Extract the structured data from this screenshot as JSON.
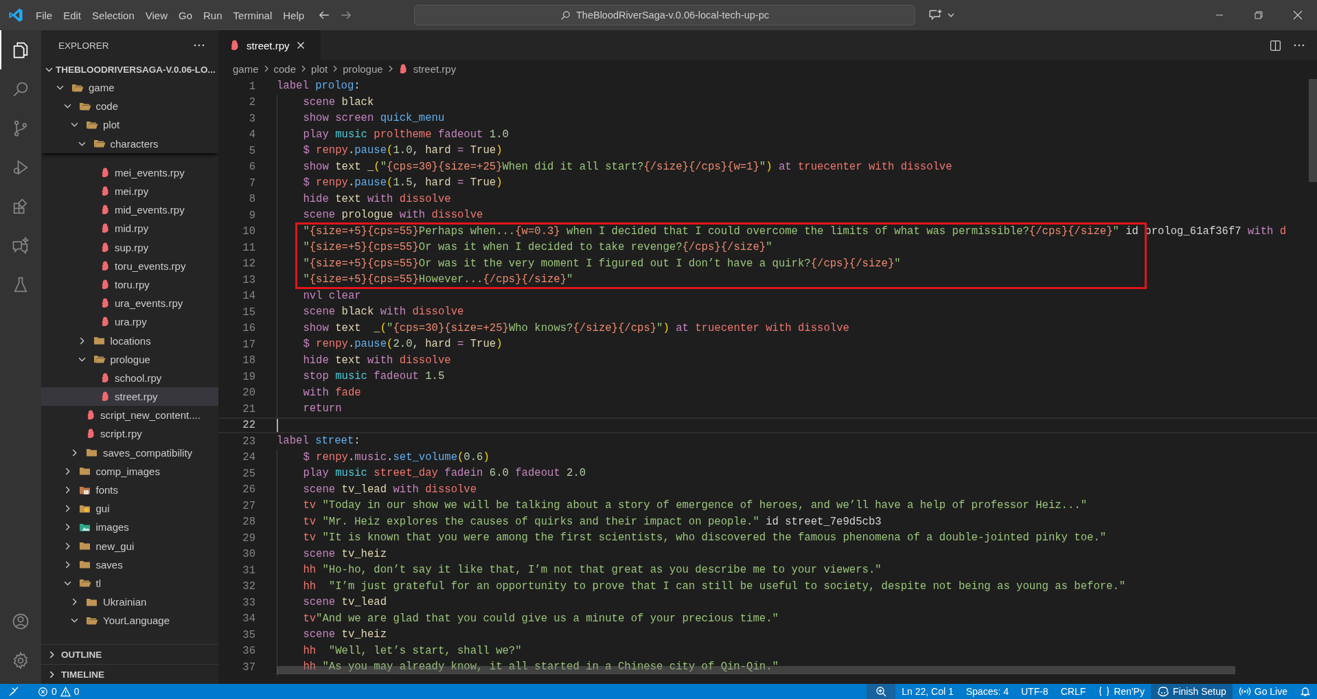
{
  "title_bar": {
    "menu": [
      "File",
      "Edit",
      "Selection",
      "View",
      "Go",
      "Run",
      "Terminal",
      "Help"
    ],
    "search": "TheBloodRiverSaga-v.0.06-local-tech-up-pc"
  },
  "activity_bar": {
    "top": [
      {
        "kind": "explorer",
        "selected": true
      },
      {
        "kind": "search",
        "selected": false
      },
      {
        "kind": "source-control",
        "selected": false
      },
      {
        "kind": "debug",
        "selected": false
      },
      {
        "kind": "extensions",
        "selected": false
      },
      {
        "kind": "chat",
        "selected": false
      },
      {
        "kind": "testing",
        "selected": false
      }
    ],
    "bottom": [
      {
        "kind": "account"
      },
      {
        "kind": "settings"
      }
    ]
  },
  "sidebar": {
    "title": "EXPLORER",
    "project": {
      "label": "THEBLOODRIVERSAGA-V.0.06-LO...",
      "expanded": true
    },
    "tree": [
      {
        "label": "game",
        "kind": "folder",
        "expanded": true,
        "selected": false,
        "children": [
          {
            "label": "code",
            "kind": "folder",
            "expanded": true,
            "selected": false,
            "children": [
              {
                "label": "plot",
                "kind": "folder",
                "expanded": true,
                "selected": false,
                "children": [
                  {
                    "label": "characters",
                    "kind": "folder",
                    "expanded": true,
                    "selected": false,
                    "children": [
                      {
                        "label": "mei_events.rpy",
                        "kind": "file",
                        "selected": false
                      },
                      {
                        "label": "mei.rpy",
                        "kind": "file",
                        "selected": false
                      },
                      {
                        "label": "mid_events.rpy",
                        "kind": "file",
                        "selected": false
                      },
                      {
                        "label": "mid.rpy",
                        "kind": "file",
                        "selected": false
                      },
                      {
                        "label": "sup.rpy",
                        "kind": "file",
                        "selected": false
                      },
                      {
                        "label": "toru_events.rpy",
                        "kind": "file",
                        "selected": false
                      },
                      {
                        "label": "toru.rpy",
                        "kind": "file",
                        "selected": false
                      },
                      {
                        "label": "ura_events.rpy",
                        "kind": "file",
                        "selected": false
                      },
                      {
                        "label": "ura.rpy",
                        "kind": "file",
                        "selected": false
                      }
                    ]
                  },
                  {
                    "label": "locations",
                    "kind": "folder",
                    "expanded": false,
                    "selected": false
                  },
                  {
                    "label": "prologue",
                    "kind": "folder",
                    "expanded": true,
                    "selected": false,
                    "children": [
                      {
                        "label": "school.rpy",
                        "kind": "file",
                        "selected": false
                      },
                      {
                        "label": "street.rpy",
                        "kind": "file",
                        "selected": true
                      }
                    ]
                  }
                ]
              },
              {
                "label": "script_new_content....",
                "kind": "file",
                "selected": false
              },
              {
                "label": "script.rpy",
                "kind": "file",
                "selected": false
              },
              {
                "label": "saves_compatibility",
                "kind": "folder",
                "expanded": false,
                "selected": false
              }
            ]
          },
          {
            "label": "comp_images",
            "kind": "folder",
            "expanded": false,
            "selected": false
          },
          {
            "label": "fonts",
            "kind": "font-folder",
            "expanded": false,
            "selected": false
          },
          {
            "label": "gui",
            "kind": "gui-folder",
            "expanded": false,
            "selected": false
          },
          {
            "label": "images",
            "kind": "image-folder",
            "expanded": false,
            "selected": false
          },
          {
            "label": "new_gui",
            "kind": "folder",
            "expanded": false,
            "selected": false
          },
          {
            "label": "saves",
            "kind": "folder",
            "expanded": false,
            "selected": false
          },
          {
            "label": "tl",
            "kind": "folder",
            "expanded": true,
            "selected": false,
            "children": [
              {
                "label": "Ukrainian",
                "kind": "folder",
                "expanded": false,
                "selected": false
              },
              {
                "label": "YourLanguage",
                "kind": "folder",
                "expanded": true,
                "selected": false
              }
            ]
          }
        ]
      }
    ],
    "sections": [
      {
        "label": "OUTLINE",
        "expanded": false
      },
      {
        "label": "TIMELINE",
        "expanded": false
      }
    ]
  },
  "tabs": [
    {
      "label": "street.rpy",
      "selected": true
    }
  ],
  "breadcrumb": [
    {
      "label": "game",
      "kind": "folder"
    },
    {
      "label": "code",
      "kind": "folder"
    },
    {
      "label": "plot",
      "kind": "folder"
    },
    {
      "label": "prologue",
      "kind": "folder"
    },
    {
      "label": "street.rpy",
      "kind": "file"
    }
  ],
  "editor": {
    "lines": [
      {
        "n": "1",
        "indented": false,
        "current": false,
        "boxed": false,
        "tokens": [
          {
            "kind": "kw",
            "text": "label "
          },
          {
            "kind": "name",
            "text": "prolog"
          },
          {
            "kind": "pl",
            "text": ":"
          }
        ]
      },
      {
        "n": "2",
        "indented": true,
        "current": false,
        "boxed": false,
        "tokens": [
          {
            "kind": "kw",
            "text": "scene "
          },
          {
            "kind": "id",
            "text": "black"
          }
        ]
      },
      {
        "n": "3",
        "indented": true,
        "current": false,
        "boxed": false,
        "tokens": [
          {
            "kind": "kw",
            "text": "show screen "
          },
          {
            "kind": "name",
            "text": "quick_menu"
          }
        ]
      },
      {
        "n": "4",
        "indented": true,
        "current": false,
        "boxed": false,
        "tokens": [
          {
            "kind": "kw",
            "text": "play "
          },
          {
            "kind": "music",
            "text": "music "
          },
          {
            "kind": "red",
            "text": "proltheme "
          },
          {
            "kind": "kw",
            "text": "fadeout "
          },
          {
            "kind": "num",
            "text": "1.0"
          }
        ]
      },
      {
        "n": "5",
        "indented": true,
        "current": false,
        "boxed": false,
        "tokens": [
          {
            "kind": "kw",
            "text": "$ "
          },
          {
            "kind": "red",
            "text": "renpy"
          },
          {
            "kind": "pl",
            "text": "."
          },
          {
            "kind": "name",
            "text": "pause"
          },
          {
            "kind": "paren",
            "text": "("
          },
          {
            "kind": "num",
            "text": "1.0"
          },
          {
            "kind": "pl",
            "text": ", "
          },
          {
            "kind": "id",
            "text": "hard "
          },
          {
            "kind": "kw",
            "text": "= "
          },
          {
            "kind": "id",
            "text": "True"
          },
          {
            "kind": "paren",
            "text": ")"
          }
        ]
      },
      {
        "n": "6",
        "indented": true,
        "current": false,
        "boxed": false,
        "tokens": [
          {
            "kind": "kw",
            "text": "show "
          },
          {
            "kind": "id",
            "text": "text _"
          },
          {
            "kind": "paren",
            "text": "("
          },
          {
            "kind": "str",
            "text": "\""
          },
          {
            "kind": "tag",
            "text": "{cps=30}{size=+25}"
          },
          {
            "kind": "str",
            "text": "When did it all start?"
          },
          {
            "kind": "tag",
            "text": "{/size}{/cps}{w=1}"
          },
          {
            "kind": "str",
            "text": "\""
          },
          {
            "kind": "paren",
            "text": ")"
          },
          {
            "kind": "kw",
            "text": " at "
          },
          {
            "kind": "red",
            "text": "truecenter with dissolve"
          }
        ]
      },
      {
        "n": "7",
        "indented": true,
        "current": false,
        "boxed": false,
        "tokens": [
          {
            "kind": "kw",
            "text": "$ "
          },
          {
            "kind": "red",
            "text": "renpy"
          },
          {
            "kind": "pl",
            "text": "."
          },
          {
            "kind": "name",
            "text": "pause"
          },
          {
            "kind": "paren",
            "text": "("
          },
          {
            "kind": "num",
            "text": "1.5"
          },
          {
            "kind": "pl",
            "text": ", "
          },
          {
            "kind": "id",
            "text": "hard "
          },
          {
            "kind": "kw",
            "text": "= "
          },
          {
            "kind": "id",
            "text": "True"
          },
          {
            "kind": "paren",
            "text": ")"
          }
        ]
      },
      {
        "n": "8",
        "indented": true,
        "current": false,
        "boxed": false,
        "tokens": [
          {
            "kind": "kw",
            "text": "hide "
          },
          {
            "kind": "id",
            "text": "text "
          },
          {
            "kind": "kw",
            "text": "with "
          },
          {
            "kind": "red",
            "text": "dissolve"
          }
        ]
      },
      {
        "n": "9",
        "indented": true,
        "current": false,
        "boxed": false,
        "tokens": [
          {
            "kind": "kw",
            "text": "scene "
          },
          {
            "kind": "id",
            "text": "prologue "
          },
          {
            "kind": "kw",
            "text": "with "
          },
          {
            "kind": "red",
            "text": "dissolve"
          }
        ]
      },
      {
        "n": "10",
        "indented": true,
        "current": false,
        "boxed": true,
        "tokens": [
          {
            "kind": "str",
            "text": "\""
          },
          {
            "kind": "tag",
            "text": "{size=+5}{cps=55}"
          },
          {
            "kind": "str",
            "text": "Perhaps when..."
          },
          {
            "kind": "tag",
            "text": "{w=0.3}"
          },
          {
            "kind": "str",
            "text": " when I decided that I could overcome the limits of what was permissible?"
          },
          {
            "kind": "tag",
            "text": "{/cps}{/size}"
          },
          {
            "kind": "str",
            "text": "\""
          },
          {
            "kind": "pl",
            "text": " id prolog_61af36f7 "
          },
          {
            "kind": "kw",
            "text": "with "
          },
          {
            "kind": "red",
            "text": "d"
          }
        ]
      },
      {
        "n": "11",
        "indented": true,
        "current": false,
        "boxed": true,
        "tokens": [
          {
            "kind": "str",
            "text": "\""
          },
          {
            "kind": "tag",
            "text": "{size=+5}{cps=55}"
          },
          {
            "kind": "str",
            "text": "Or was it when I decided to take revenge?"
          },
          {
            "kind": "tag",
            "text": "{/cps}{/size}"
          },
          {
            "kind": "str",
            "text": "\""
          }
        ]
      },
      {
        "n": "12",
        "indented": true,
        "current": false,
        "boxed": true,
        "tokens": [
          {
            "kind": "str",
            "text": "\""
          },
          {
            "kind": "tag",
            "text": "{size=+5}{cps=55}"
          },
          {
            "kind": "str",
            "text": "Or was it the very moment I figured out I don’t have a quirk?"
          },
          {
            "kind": "tag",
            "text": "{/cps}{/size}"
          },
          {
            "kind": "str",
            "text": "\""
          }
        ]
      },
      {
        "n": "13",
        "indented": true,
        "current": false,
        "boxed": true,
        "tokens": [
          {
            "kind": "str",
            "text": "\""
          },
          {
            "kind": "tag",
            "text": "{size=+5}{cps=55}"
          },
          {
            "kind": "str",
            "text": "However..."
          },
          {
            "kind": "tag",
            "text": "{/cps}{/size}"
          },
          {
            "kind": "str",
            "text": "\""
          }
        ]
      },
      {
        "n": "14",
        "indented": true,
        "current": false,
        "boxed": false,
        "tokens": [
          {
            "kind": "kw",
            "text": "nvl clear"
          }
        ]
      },
      {
        "n": "15",
        "indented": true,
        "current": false,
        "boxed": false,
        "tokens": [
          {
            "kind": "kw",
            "text": "scene "
          },
          {
            "kind": "id",
            "text": "black "
          },
          {
            "kind": "kw",
            "text": "with "
          },
          {
            "kind": "red",
            "text": "dissolve"
          }
        ]
      },
      {
        "n": "16",
        "indented": true,
        "current": false,
        "boxed": false,
        "tokens": [
          {
            "kind": "kw",
            "text": "show "
          },
          {
            "kind": "id",
            "text": "text  _"
          },
          {
            "kind": "paren",
            "text": "("
          },
          {
            "kind": "str",
            "text": "\""
          },
          {
            "kind": "tag",
            "text": "{cps=30}{size=+25}"
          },
          {
            "kind": "str",
            "text": "Who knows?"
          },
          {
            "kind": "tag",
            "text": "{/size}{/cps}"
          },
          {
            "kind": "str",
            "text": "\""
          },
          {
            "kind": "paren",
            "text": ")"
          },
          {
            "kind": "kw",
            "text": " at "
          },
          {
            "kind": "red",
            "text": "truecenter with dissolve"
          }
        ]
      },
      {
        "n": "17",
        "indented": true,
        "current": false,
        "boxed": false,
        "tokens": [
          {
            "kind": "kw",
            "text": "$ "
          },
          {
            "kind": "red",
            "text": "renpy"
          },
          {
            "kind": "pl",
            "text": "."
          },
          {
            "kind": "name",
            "text": "pause"
          },
          {
            "kind": "paren",
            "text": "("
          },
          {
            "kind": "num",
            "text": "2.0"
          },
          {
            "kind": "pl",
            "text": ", "
          },
          {
            "kind": "id",
            "text": "hard "
          },
          {
            "kind": "kw",
            "text": "= "
          },
          {
            "kind": "id",
            "text": "True"
          },
          {
            "kind": "paren",
            "text": ")"
          }
        ]
      },
      {
        "n": "18",
        "indented": true,
        "current": false,
        "boxed": false,
        "tokens": [
          {
            "kind": "kw",
            "text": "hide "
          },
          {
            "kind": "id",
            "text": "text "
          },
          {
            "kind": "kw",
            "text": "with "
          },
          {
            "kind": "red",
            "text": "dissolve"
          }
        ]
      },
      {
        "n": "19",
        "indented": true,
        "current": false,
        "boxed": false,
        "tokens": [
          {
            "kind": "kw",
            "text": "stop "
          },
          {
            "kind": "music",
            "text": "music "
          },
          {
            "kind": "kw",
            "text": "fadeout "
          },
          {
            "kind": "num",
            "text": "1.5"
          }
        ]
      },
      {
        "n": "20",
        "indented": true,
        "current": false,
        "boxed": false,
        "tokens": [
          {
            "kind": "kw",
            "text": "with "
          },
          {
            "kind": "red",
            "text": "fade"
          }
        ]
      },
      {
        "n": "21",
        "indented": true,
        "current": false,
        "boxed": false,
        "tokens": [
          {
            "kind": "kw",
            "text": "return"
          }
        ]
      },
      {
        "n": "22",
        "indented": false,
        "current": true,
        "boxed": false
      },
      {
        "n": "23",
        "indented": false,
        "current": false,
        "boxed": false,
        "tokens": [
          {
            "kind": "kw",
            "text": "label "
          },
          {
            "kind": "name",
            "text": "street"
          },
          {
            "kind": "pl",
            "text": ":"
          }
        ]
      },
      {
        "n": "24",
        "indented": true,
        "current": false,
        "boxed": false,
        "tokens": [
          {
            "kind": "kw",
            "text": "$ "
          },
          {
            "kind": "red",
            "text": "renpy"
          },
          {
            "kind": "pl",
            "text": "."
          },
          {
            "kind": "kw",
            "text": "music"
          },
          {
            "kind": "pl",
            "text": "."
          },
          {
            "kind": "name",
            "text": "set_volume"
          },
          {
            "kind": "paren",
            "text": "("
          },
          {
            "kind": "num",
            "text": "0.6"
          },
          {
            "kind": "paren",
            "text": ")"
          }
        ]
      },
      {
        "n": "25",
        "indented": true,
        "current": false,
        "boxed": false,
        "tokens": [
          {
            "kind": "kw",
            "text": "play "
          },
          {
            "kind": "music",
            "text": "music "
          },
          {
            "kind": "red",
            "text": "street_day "
          },
          {
            "kind": "kw",
            "text": "fadein "
          },
          {
            "kind": "num",
            "text": "6.0 "
          },
          {
            "kind": "kw",
            "text": "fadeout "
          },
          {
            "kind": "num",
            "text": "2.0"
          }
        ]
      },
      {
        "n": "26",
        "indented": true,
        "current": false,
        "boxed": false,
        "tokens": [
          {
            "kind": "kw",
            "text": "scene "
          },
          {
            "kind": "id",
            "text": "tv_lead "
          },
          {
            "kind": "kw",
            "text": "with "
          },
          {
            "kind": "red",
            "text": "dissolve"
          }
        ]
      },
      {
        "n": "27",
        "indented": true,
        "current": false,
        "boxed": false,
        "tokens": [
          {
            "kind": "red",
            "text": "tv "
          },
          {
            "kind": "str",
            "text": "\"Today in our show we will be talking about a story of emergence of heroes, and we’ll have a help of professor Heiz...\""
          }
        ]
      },
      {
        "n": "28",
        "indented": true,
        "current": false,
        "boxed": false,
        "tokens": [
          {
            "kind": "red",
            "text": "tv "
          },
          {
            "kind": "str",
            "text": "\"Mr. Heiz explores the causes of quirks and their impact on people.\""
          },
          {
            "kind": "pl",
            "text": " id street_7e9d5cb3"
          }
        ]
      },
      {
        "n": "29",
        "indented": true,
        "current": false,
        "boxed": false,
        "tokens": [
          {
            "kind": "red",
            "text": "tv "
          },
          {
            "kind": "str",
            "text": "\"It is known that you were among the first scientists, who discovered the famous phenomena of a double-jointed pinky toe.\""
          }
        ]
      },
      {
        "n": "30",
        "indented": true,
        "current": false,
        "boxed": false,
        "tokens": [
          {
            "kind": "kw",
            "text": "scene "
          },
          {
            "kind": "id",
            "text": "tv_heiz"
          }
        ]
      },
      {
        "n": "31",
        "indented": true,
        "current": false,
        "boxed": false,
        "tokens": [
          {
            "kind": "red",
            "text": "hh "
          },
          {
            "kind": "str",
            "text": "\"Ho-ho, don’t say it like that, I’m not that great as you describe me to your viewers.\""
          }
        ]
      },
      {
        "n": "32",
        "indented": true,
        "current": false,
        "boxed": false,
        "tokens": [
          {
            "kind": "red",
            "text": "hh  "
          },
          {
            "kind": "str",
            "text": "\"I’m just grateful for an opportunity to prove that I can still be useful to society, despite not being as young as before.\""
          }
        ]
      },
      {
        "n": "33",
        "indented": true,
        "current": false,
        "boxed": false,
        "tokens": [
          {
            "kind": "kw",
            "text": "scene "
          },
          {
            "kind": "id",
            "text": "tv_lead"
          }
        ]
      },
      {
        "n": "34",
        "indented": true,
        "current": false,
        "boxed": false,
        "tokens": [
          {
            "kind": "red",
            "text": "tv"
          },
          {
            "kind": "str",
            "text": "\"And we are glad that you could give us a minute of your precious time.\""
          }
        ]
      },
      {
        "n": "35",
        "indented": true,
        "current": false,
        "boxed": false,
        "tokens": [
          {
            "kind": "kw",
            "text": "scene "
          },
          {
            "kind": "id",
            "text": "tv_heiz"
          }
        ]
      },
      {
        "n": "36",
        "indented": true,
        "current": false,
        "boxed": false,
        "tokens": [
          {
            "kind": "red",
            "text": "hh  "
          },
          {
            "kind": "str",
            "text": "\"Well, let’s start, shall we?\""
          }
        ]
      },
      {
        "n": "37",
        "indented": true,
        "current": false,
        "boxed": false,
        "tokens": [
          {
            "kind": "red",
            "text": "hh "
          },
          {
            "kind": "str",
            "text": "\"As you may already know, it all started in a Chinese city of Qin-Qin.\""
          }
        ]
      }
    ]
  },
  "status_bar": {
    "errors": "0",
    "warnings": "0",
    "items": [
      {
        "kind": "zoom"
      },
      {
        "kind": "text",
        "text": "Ln 22, Col 1"
      },
      {
        "kind": "text",
        "text": "Spaces: 4"
      },
      {
        "kind": "text",
        "text": "UTF-8"
      },
      {
        "kind": "text",
        "text": "CRLF"
      },
      {
        "kind": "language",
        "text": "Ren'Py"
      },
      {
        "kind": "copilot",
        "text": "Finish Setup"
      },
      {
        "kind": "live",
        "text": "Go Live"
      },
      {
        "kind": "bell"
      }
    ]
  }
}
